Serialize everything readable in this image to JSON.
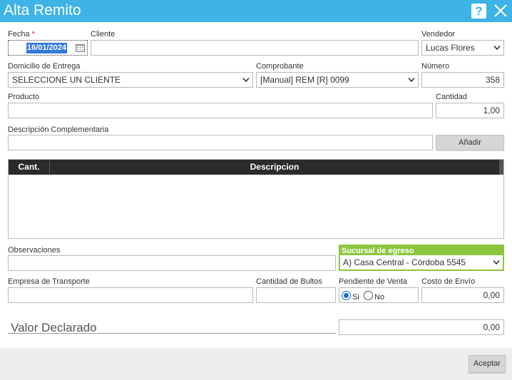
{
  "window": {
    "title": "Alta Remito",
    "help": "?"
  },
  "fecha": {
    "label": "Fecha",
    "required_mark": "*",
    "value": "16/01/2024"
  },
  "cliente": {
    "label": "Cliente",
    "value": ""
  },
  "vendedor": {
    "label": "Vendedor",
    "value": "Lucas Flores"
  },
  "domicilio": {
    "label": "Domicilio de Entrega",
    "value": "SELECCIONE UN CLIENTE"
  },
  "comprobante": {
    "label": "Comprobante",
    "value": "[Manual] REM [R] 0099"
  },
  "numero": {
    "label": "Número",
    "value": "358"
  },
  "producto": {
    "label": "Producto",
    "value": ""
  },
  "cantidad": {
    "label": "Cantidad",
    "value": "1,00"
  },
  "descripcion": {
    "label": "Descripción Complementaria",
    "value": ""
  },
  "add_button": "Añadir",
  "grid": {
    "columns": [
      "Cant.",
      "Descripcion"
    ],
    "rows": []
  },
  "observaciones": {
    "label": "Observaciones",
    "value": ""
  },
  "sucursal": {
    "label": "Sucursal de egreso",
    "value": "A) Casa Central - Córdoba 5545"
  },
  "transporte": {
    "label": "Empresa de Transporte",
    "value": ""
  },
  "bultos": {
    "label": "Cantidad de Bultos",
    "value": ""
  },
  "pendiente": {
    "label": "Pendiente de Venta",
    "options": [
      "Si",
      "No"
    ],
    "selected": "Si"
  },
  "costo": {
    "label": "Costo de Envío",
    "value": "0,00"
  },
  "valor": {
    "label": "Valor Declarado",
    "value": "0,00"
  },
  "accept_button": "Aceptar",
  "colors": {
    "header": "#3db3e6",
    "sucursal": "#8cc63f",
    "grid_header": "#2b2b2b",
    "required": "#dd2222"
  }
}
